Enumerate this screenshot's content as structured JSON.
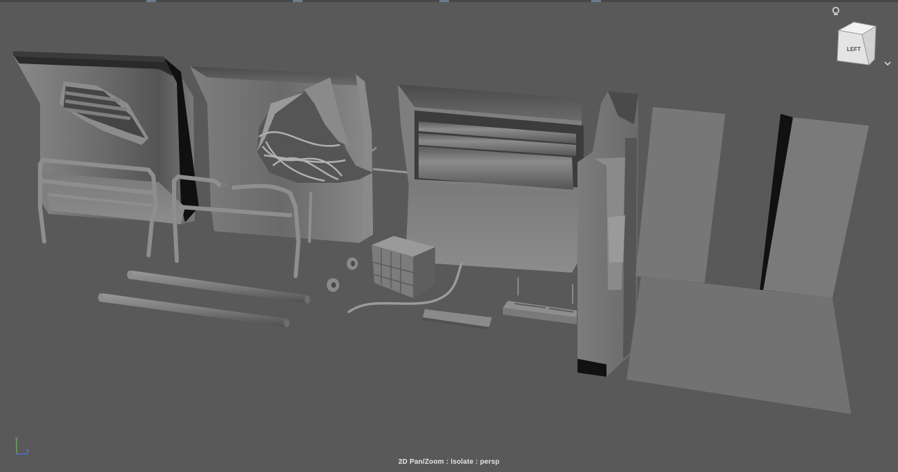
{
  "viewport": {
    "hud_label": "2D Pan/Zoom : Isolate : persp",
    "view_cube": {
      "face_top_label": "",
      "face_front_label": "LEFT"
    },
    "axis_gizmo": {
      "y": "y",
      "z": "z"
    },
    "background_color": "#595959",
    "top_strip_marks": 4
  },
  "icons": {
    "home": "home-icon",
    "view_cube_menu": "chevron-down-icon"
  },
  "objects": [
    "panel-with-vent-damage",
    "panel-with-torn-hole-and-cables",
    "panel-with-pipes",
    "vertical-pillar",
    "wall-floor-section",
    "railing-left",
    "railing-middle",
    "pipe-upper",
    "pipe-lower",
    "nut-small",
    "nut-large",
    "junction-box",
    "hanging-cable",
    "floor-plate",
    "tray-bracket"
  ]
}
